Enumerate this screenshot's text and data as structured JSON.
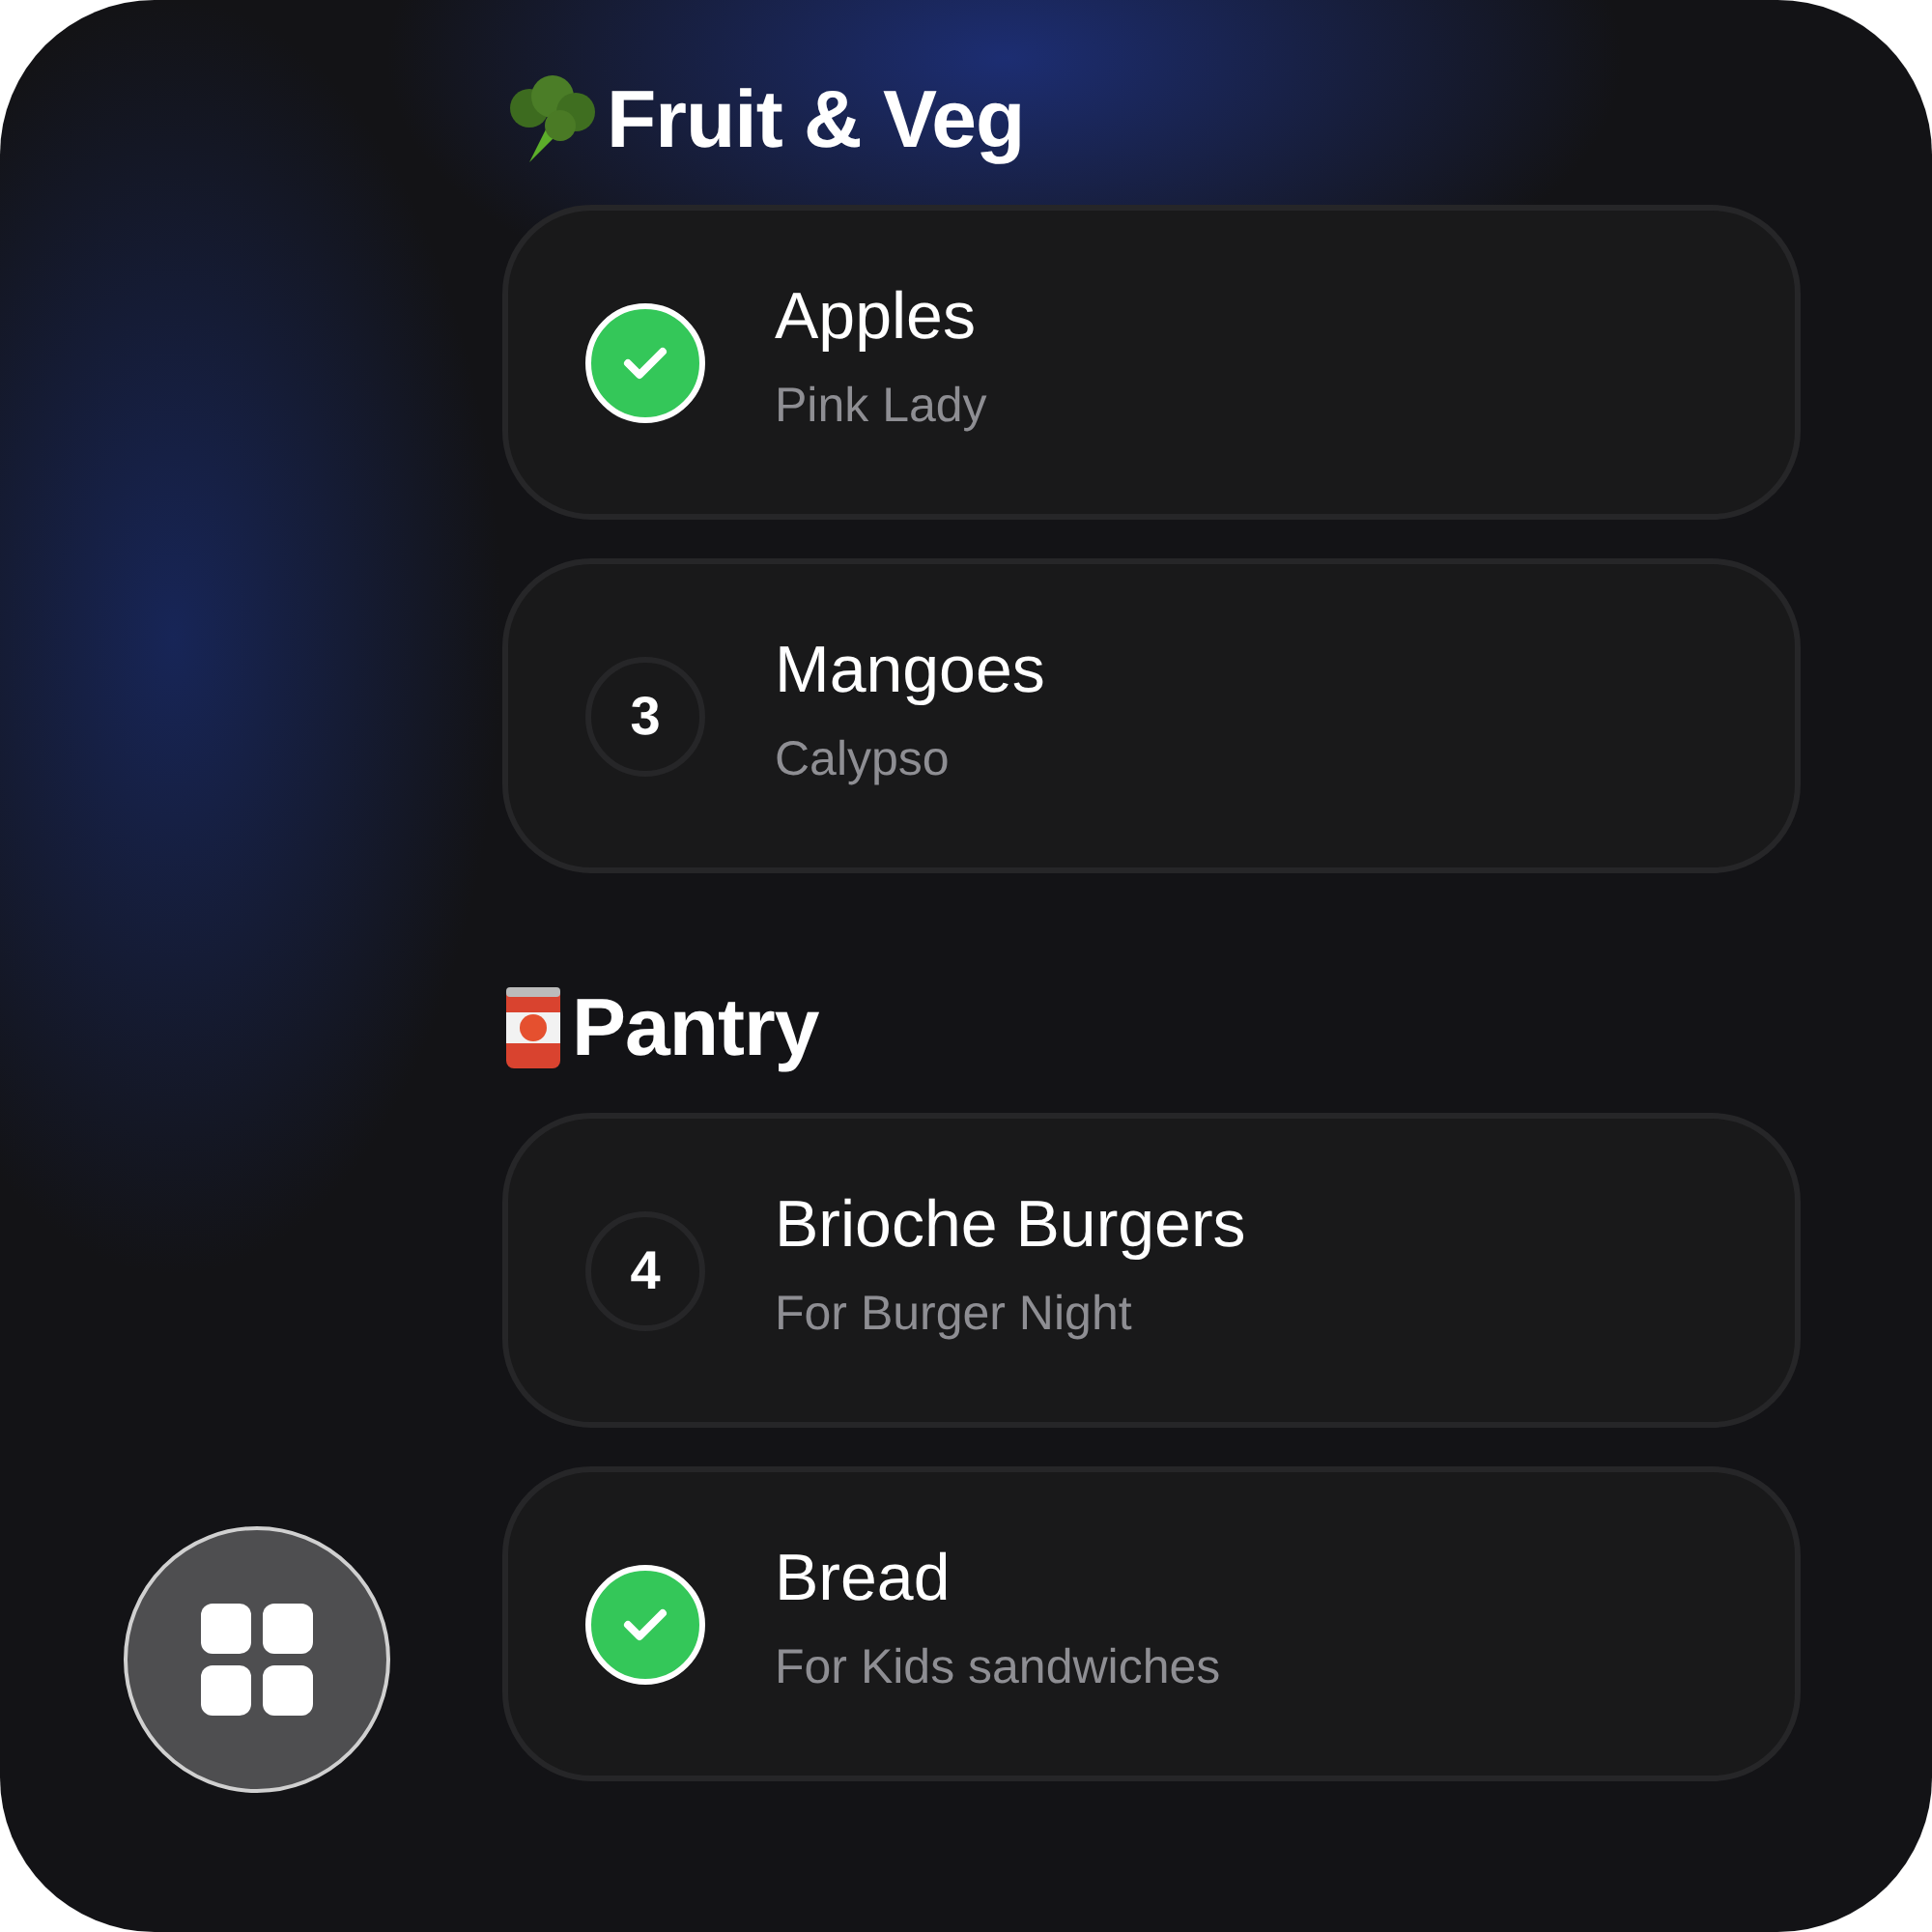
{
  "sections": [
    {
      "title": "Fruit & Veg",
      "items": [
        {
          "checked": true,
          "name": "Apples",
          "note": "Pink Lady"
        },
        {
          "checked": false,
          "count": "3",
          "name": "Mangoes",
          "note": "Calypso"
        }
      ]
    },
    {
      "title": "Pantry",
      "items": [
        {
          "checked": false,
          "count": "4",
          "name": "Brioche Burgers",
          "note": "For Burger Night"
        },
        {
          "checked": true,
          "name": "Bread",
          "note": "For Kids sandwiches"
        }
      ]
    }
  ]
}
